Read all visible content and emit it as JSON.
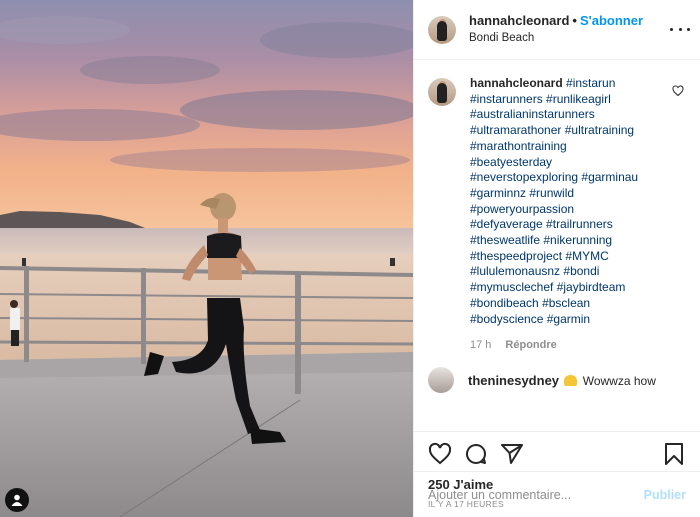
{
  "post": {
    "username": "hannahcleonard",
    "separator": "•",
    "follow_label": "S'abonner",
    "location": "Bondi Beach",
    "image_icon": "person-tag-icon"
  },
  "caption": {
    "username": "hannahcleonard",
    "hashtags": [
      "#instarun",
      "#instarunners #runlikeagirl",
      "#australianinstarunners",
      "#ultramarathoner #ultratraining",
      "#marathontraining",
      "#beatyesterday",
      "#neverstopexploring #garminau",
      "#garminnz #runwild",
      "#poweryourpassion",
      "#defyaverage #trailrunners",
      "#thesweatlife #nikerunning",
      "#thespeedproject #MYMC",
      "#lululemonausnz #bondi",
      "#mymusclechef #jaybirdteam",
      "#bondibeach #bsclean",
      "#bodyscience #garmin"
    ],
    "age": "17 h",
    "reply_label": "Répondre"
  },
  "next_comment": {
    "username": "theninesydney",
    "text": "Wowwza how"
  },
  "stats": {
    "likes": "250 J'aime",
    "time": "IL Y A 17 HEURES"
  },
  "comment_box": {
    "placeholder": "Ajouter un commentaire...",
    "post_label": "Publier"
  },
  "icons": {
    "like": "heart-icon",
    "comment": "comment-icon",
    "share": "share-icon",
    "save": "bookmark-icon",
    "more": "more-options-icon"
  },
  "colors": {
    "link": "#0095f6",
    "hashtag": "#00376b",
    "muted": "#8e8e8e"
  }
}
